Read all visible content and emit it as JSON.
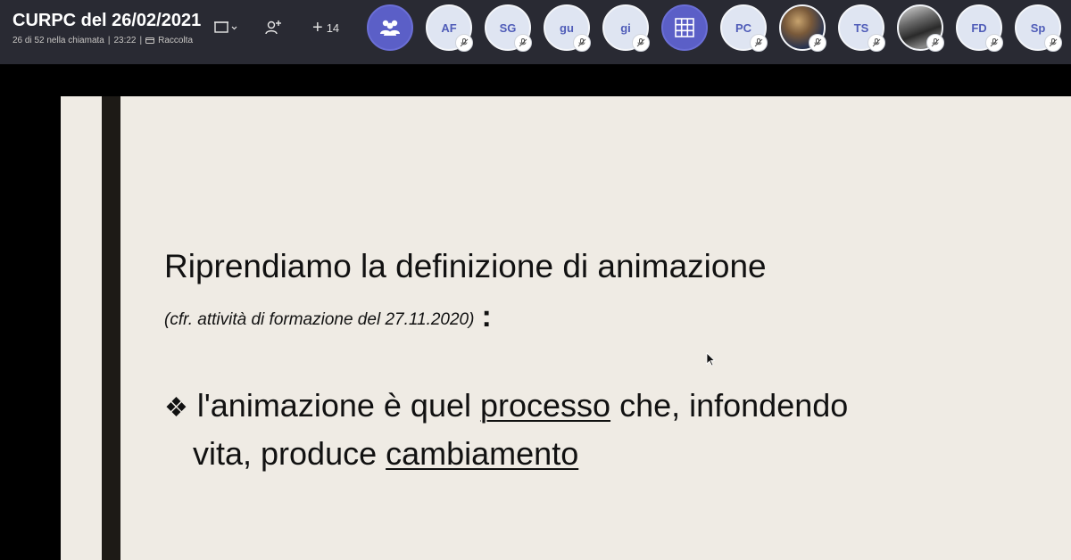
{
  "meeting": {
    "title": "CURPC del 26/02/2021",
    "participants_status": "26 di 52 nella chiamata",
    "separator": "|",
    "duration": "23:22",
    "separator2": "|",
    "recording_label": "Raccolta"
  },
  "toolbar": {
    "layout_icon": "layout-icon",
    "add_people_icon": "add-people-icon",
    "more_participants": "14",
    "more_plus": "+"
  },
  "participants": [
    {
      "type": "icon",
      "icon": "people-group-icon",
      "initials": ""
    },
    {
      "type": "initials",
      "initials": "AF",
      "muted": true
    },
    {
      "type": "initials",
      "initials": "SG",
      "muted": true
    },
    {
      "type": "initials",
      "initials": "gu",
      "muted": true
    },
    {
      "type": "initials",
      "initials": "gi",
      "muted": true
    },
    {
      "type": "icon",
      "icon": "grid-icon",
      "initials": ""
    },
    {
      "type": "initials",
      "initials": "PC",
      "muted": true
    },
    {
      "type": "photo",
      "initials": "",
      "muted": true
    },
    {
      "type": "initials",
      "initials": "TS",
      "muted": true
    },
    {
      "type": "photo",
      "initials": "",
      "muted": true
    },
    {
      "type": "initials",
      "initials": "FD",
      "muted": true
    },
    {
      "type": "initials",
      "initials": "Sp",
      "muted": true
    }
  ],
  "slide": {
    "title": "Riprendiamo la definizione di animazione",
    "subtitle": "(cfr. attività di formazione del 27.11.2020)",
    "subtitle_colon": ":",
    "bullet_symbol": "❖",
    "bullet_part1": "l'animazione è quel ",
    "bullet_keyword1": "processo",
    "bullet_part2": " che, infondendo",
    "bullet_line2_part1": "vita, produce ",
    "bullet_keyword2": "cambiamento"
  },
  "colors": {
    "topbar_bg": "#292a33",
    "accent_purple": "#5b5fc7",
    "avatar_bg": "#dfe5f2",
    "avatar_text": "#4f5cb8",
    "slide_bg": "#efebe4",
    "slide_bar": "#1d1a16"
  }
}
